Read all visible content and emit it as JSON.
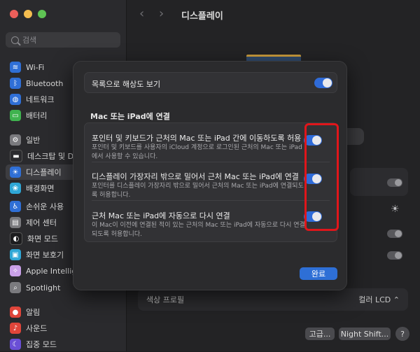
{
  "window": {
    "title": "디스플레이"
  },
  "sidebar": {
    "search_placeholder": "검색",
    "items": [
      {
        "label": "Wi-Fi",
        "icon": "wifi-icon",
        "color": "#2f6fd6"
      },
      {
        "label": "Bluetooth",
        "icon": "bluetooth-icon",
        "color": "#2f6fd6"
      },
      {
        "label": "네트워크",
        "icon": "network-icon",
        "color": "#2f6fd6"
      },
      {
        "label": "배터리",
        "icon": "battery-icon",
        "color": "#3fb34f"
      },
      {
        "label": "일반",
        "icon": "gear-icon",
        "color": "#7a7a7e"
      },
      {
        "label": "데스크탑 및 Dock",
        "icon": "desktop-dock-icon",
        "color": "#2b2b2e"
      },
      {
        "label": "디스플레이",
        "icon": "display-icon",
        "color": "#2f6fd6"
      },
      {
        "label": "배경화면",
        "icon": "wallpaper-icon",
        "color": "#2fa7d6"
      },
      {
        "label": "손쉬운 사용",
        "icon": "accessibility-icon",
        "color": "#2f6fd6"
      },
      {
        "label": "제어 센터",
        "icon": "control-center-icon",
        "color": "#7a7a7e"
      },
      {
        "label": "화면 모드",
        "icon": "appearance-icon",
        "color": "#1d1d1f"
      },
      {
        "label": "화면 보호기",
        "icon": "screensaver-icon",
        "color": "#2fa7d6"
      },
      {
        "label": "Apple Intelligence",
        "icon": "apple-intelligence-icon",
        "color": "#c9a0e8"
      },
      {
        "label": "Spotlight",
        "icon": "spotlight-icon",
        "color": "#7a7a7e"
      },
      {
        "label": "알림",
        "icon": "notifications-icon",
        "color": "#e0453a"
      },
      {
        "label": "사운드",
        "icon": "sound-icon",
        "color": "#e0453a"
      },
      {
        "label": "집중 모드",
        "icon": "focus-icon",
        "color": "#6a4fd6"
      }
    ],
    "active_label": "디스플레이"
  },
  "main": {
    "color_profile_label": "색상 프로필",
    "color_profile_value": "컬러 LCD",
    "advanced_button": "고급...",
    "night_shift_button": "Night Shift...",
    "help_button": "?"
  },
  "sheet": {
    "list_resolution_label": "목록으로 해상도 보기",
    "list_resolution_on": true,
    "section_title": "Mac 또는 iPad에 연결",
    "items": [
      {
        "title": "포인터 및 키보드가 근처의 Mac 또는 iPad 간에 이동하도록 허용",
        "description": "포인터 및 키보드를 사용자의 iCloud 계정으로 로그인된 근처의 Mac 또는 iPad에서 사용할 수 있습니다.",
        "enabled": true
      },
      {
        "title": "디스플레이 가장자리 밖으로 밀어서 근처 Mac 또는 iPad에 연결",
        "description": "포인터를 디스플레이 가장자리 밖으로 밀어서 근처의 Mac 또는 iPad에 연결되도록 허용합니다.",
        "enabled": true
      },
      {
        "title": "근처 Mac 또는 iPad에 자동으로 다시 연결",
        "description": "이 Mac이 이전에 연결된 적이 있는 근처의 Mac 또는 iPad에 자동으로 다시 연결되도록 허용합니다.",
        "enabled": true
      }
    ],
    "done_button": "완료"
  },
  "colors": {
    "accent": "#2e6fd6",
    "highlight": "#e0161b"
  }
}
